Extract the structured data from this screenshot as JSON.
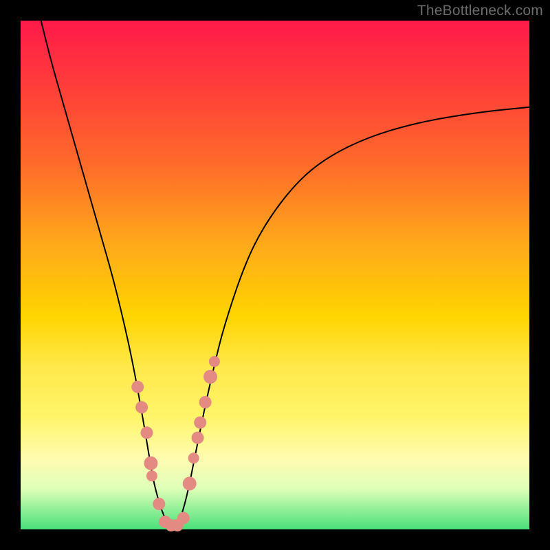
{
  "watermark": "TheBottleneck.com",
  "chart_data": {
    "type": "line",
    "title": "",
    "xlabel": "",
    "ylabel": "",
    "xlim": [
      0,
      100
    ],
    "ylim": [
      0,
      100
    ],
    "grid": false,
    "legend": false,
    "series": [
      {
        "name": "curve",
        "x": [
          4,
          6,
          8,
          10,
          12,
          14,
          16,
          18,
          20,
          22,
          24,
          25,
          26,
          27,
          28,
          29,
          30,
          31,
          32,
          33,
          34,
          36,
          38,
          40,
          44,
          48,
          54,
          60,
          68,
          78,
          90,
          100
        ],
        "y": [
          100,
          92,
          85,
          78,
          71,
          64,
          57,
          50,
          42,
          33,
          22,
          16,
          10,
          6,
          3,
          1,
          0,
          1,
          4,
          8,
          13,
          23,
          32,
          40,
          52,
          60,
          68,
          73,
          77,
          80,
          82,
          83
        ]
      }
    ],
    "markers": {
      "left_cluster": [
        {
          "x": 23.0,
          "y": 28,
          "r": 9
        },
        {
          "x": 23.8,
          "y": 24,
          "r": 9
        },
        {
          "x": 24.8,
          "y": 19,
          "r": 9
        },
        {
          "x": 25.6,
          "y": 13,
          "r": 10
        },
        {
          "x": 25.8,
          "y": 10.5,
          "r": 8
        },
        {
          "x": 27.2,
          "y": 5,
          "r": 9
        }
      ],
      "right_cluster": [
        {
          "x": 33.2,
          "y": 9,
          "r": 10
        },
        {
          "x": 34.0,
          "y": 14,
          "r": 8
        },
        {
          "x": 34.8,
          "y": 18,
          "r": 9
        },
        {
          "x": 35.3,
          "y": 21,
          "r": 9
        },
        {
          "x": 36.3,
          "y": 25,
          "r": 9
        },
        {
          "x": 37.3,
          "y": 30,
          "r": 10
        },
        {
          "x": 38.1,
          "y": 33,
          "r": 8
        }
      ],
      "bottom_cluster": [
        {
          "x": 28.4,
          "y": 1.5,
          "r": 9
        },
        {
          "x": 29.6,
          "y": 0.8,
          "r": 9
        },
        {
          "x": 30.8,
          "y": 0.8,
          "r": 9
        },
        {
          "x": 32.0,
          "y": 2.2,
          "r": 9
        }
      ]
    }
  }
}
